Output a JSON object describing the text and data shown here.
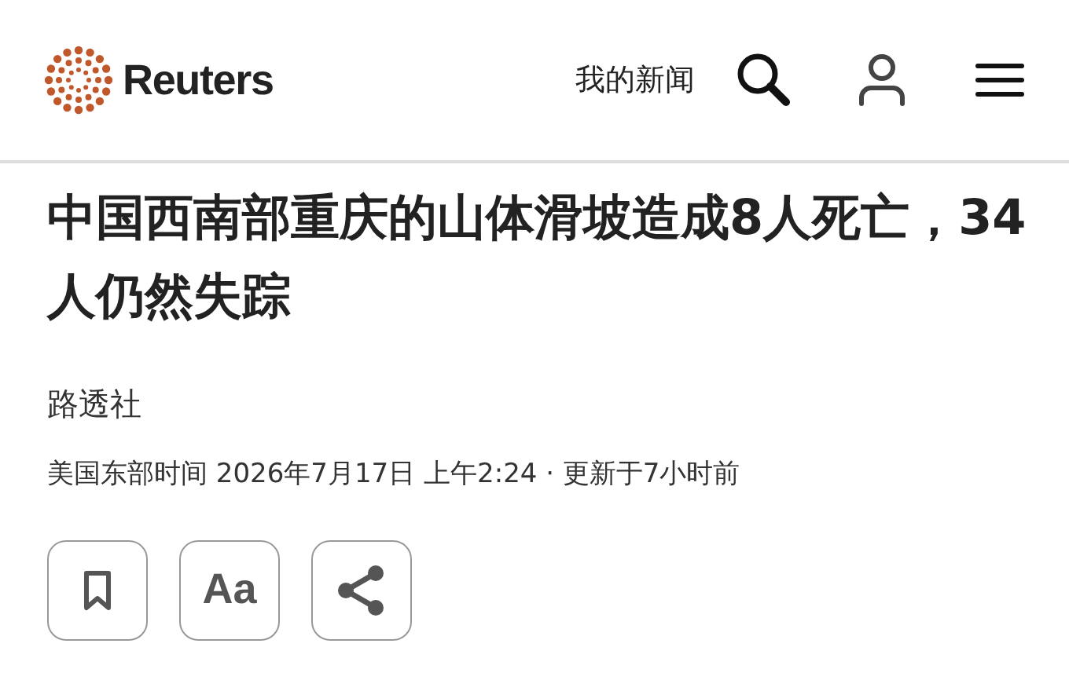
{
  "header": {
    "brand": "Reuters",
    "my_news": "我的新闻"
  },
  "article": {
    "headline": "中国西南部重庆的山体滑坡造成8人死亡，34人仍然失踪",
    "byline": "路透社",
    "timestamp": "美国东部时间 2026年7月17日 上午2:24 · 更新于7小时前"
  },
  "actions": [
    {
      "kind": "bookmark"
    },
    {
      "kind": "text",
      "label": "Aa"
    },
    {
      "kind": "share"
    }
  ]
}
